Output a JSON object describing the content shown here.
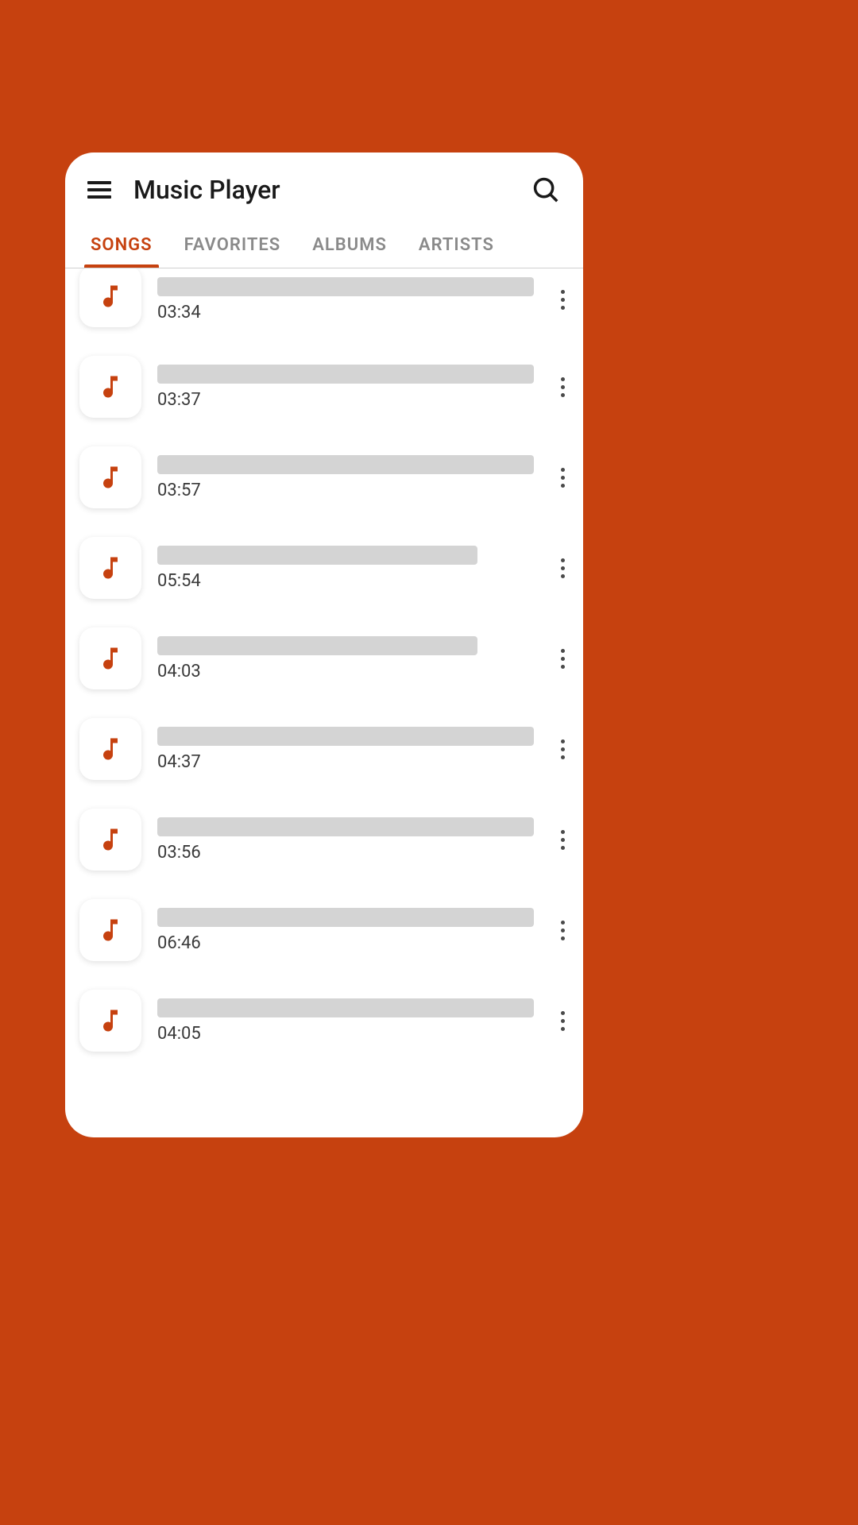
{
  "header": {
    "title": "Music Player"
  },
  "tabs": [
    {
      "label": "SONGS",
      "active": true
    },
    {
      "label": "FAVORITES",
      "active": false
    },
    {
      "label": "ALBUMS",
      "active": false
    },
    {
      "label": "ARTISTS",
      "active": false
    }
  ],
  "songs": [
    {
      "duration": "03:34"
    },
    {
      "duration": "03:37"
    },
    {
      "duration": "03:57"
    },
    {
      "duration": "05:54"
    },
    {
      "duration": "04:03"
    },
    {
      "duration": "04:37"
    },
    {
      "duration": "03:56"
    },
    {
      "duration": "06:46"
    },
    {
      "duration": "04:05"
    }
  ],
  "colors": {
    "accent": "#c6410f",
    "background": "#c6410f"
  }
}
